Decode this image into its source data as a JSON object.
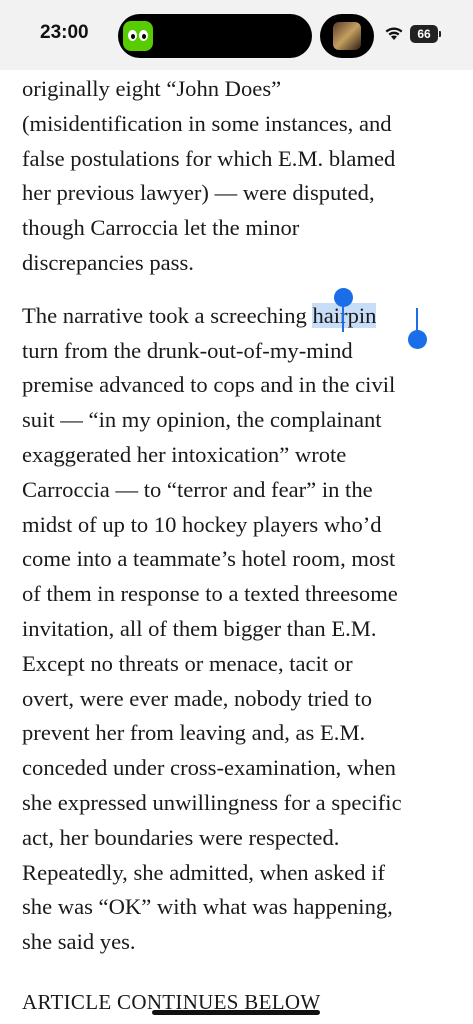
{
  "status_bar": {
    "time": "23:00",
    "battery": "66",
    "dynamic_island_left_icon": "duolingo-icon",
    "dynamic_island_right_icon": "now-playing-artwork",
    "wifi_icon": "wifi-icon"
  },
  "article": {
    "paragraph_1": [
      "originally eight “John Does”",
      "(misidentification in some instances, and",
      "false postulations for which E.M. blamed",
      "her previous lawyer) — were disputed,",
      "though Carroccia let the minor",
      "discrepancies pass."
    ],
    "paragraph_2": {
      "first_line_before": "The narrative took a screeching ",
      "selected_word": "hairpin",
      "lines": [
        "turn from the drunk-out-of-my-mind",
        "premise advanced to cops and in the civil",
        "suit — “in my opinion, the complainant",
        "exaggerated her intoxication” wrote",
        "Carroccia — to “terror and fear” in the",
        "midst of up to 10 hockey players who’d",
        "come into a teammate’s hotel room, most",
        "of them in response to a texted threesome",
        "invitation, all of them bigger than E.M.",
        "Except no threats or menace, tacit or",
        "overt, were ever made, nobody tried to",
        "prevent her from leaving and, as E.M.",
        "conceded under cross-examination, when",
        "she expressed unwillingness for a specific",
        "act, her boundaries were respected.",
        "Repeatedly, she admitted, when asked if",
        "she was “OK” with what was happening,",
        "she said yes."
      ]
    },
    "continues_label": "ARTICLE CONTINUES BELOW"
  },
  "colors": {
    "selection_highlight": "#c8ddf7",
    "selection_handle": "#1a6ee8",
    "status_bar_bg": "#f2f2f2"
  }
}
